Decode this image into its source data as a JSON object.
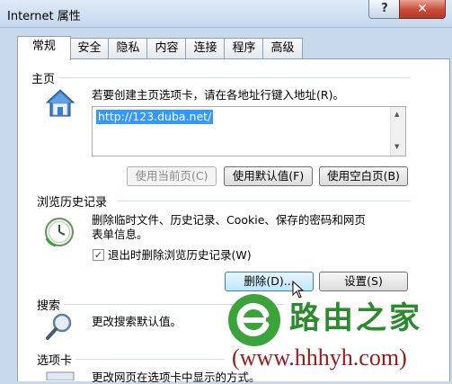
{
  "window": {
    "title": "Internet 属性",
    "help_label": "?",
    "close_label": "✕"
  },
  "tabs": [
    "常规",
    "安全",
    "隐私",
    "内容",
    "连接",
    "程序",
    "高级"
  ],
  "homepage": {
    "group_label": "主页",
    "description": "若要创建主页选项卡，请在各地址行键入地址(R)。",
    "url": "http://123.duba.net/",
    "buttons": {
      "use_current": "使用当前页(C)",
      "use_default": "使用默认值(F)",
      "use_blank": "使用空白页(B)"
    }
  },
  "history": {
    "group_label": "浏览历史记录",
    "description_line1": "删除临时文件、历史记录、Cookie、保存的密码和网页",
    "description_line2": "表单信息。",
    "checkbox_label": "退出时删除浏览历史记录(W)",
    "checkbox_checked": true,
    "delete_button": "删除(D)...",
    "settings_button": "设置(S)"
  },
  "search": {
    "group_label": "搜索",
    "description": "更改搜索默认值。"
  },
  "tabs_group": {
    "group_label": "选项卡",
    "description": "更改网页在选项卡中显示的方式。"
  },
  "watermark": {
    "brand": "路由之家",
    "url": "(www.hhhyh.com)"
  },
  "icons": {
    "homepage": "house-icon",
    "history": "clock-icon",
    "search": "magnifier-icon",
    "tabs": "tabs-icon",
    "watermark": "e-logo-icon"
  }
}
